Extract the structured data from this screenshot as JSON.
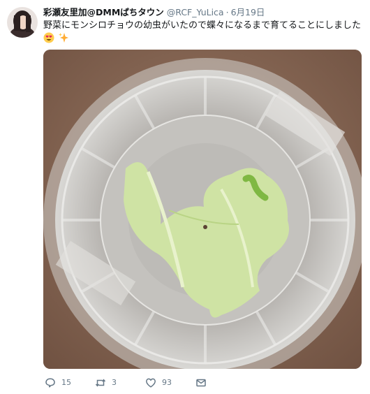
{
  "tweet": {
    "display_name": "彩瀬友里加@DMMぱちタウン",
    "handle": "@RCF_YuLica",
    "dot": "·",
    "date": "6月19日",
    "text": "野菜にモンシロチョウの幼虫がいたので蝶々になるまで育てることにしました",
    "emojis": [
      "smiling-face-with-heart-eyes",
      "sparkles"
    ],
    "media_alt": ""
  },
  "actions": {
    "reply_count": "15",
    "retweet_count": "3",
    "like_count": "93"
  },
  "colors": {
    "text": "#14171a",
    "secondary": "#657786",
    "table": "#8a6a55"
  }
}
